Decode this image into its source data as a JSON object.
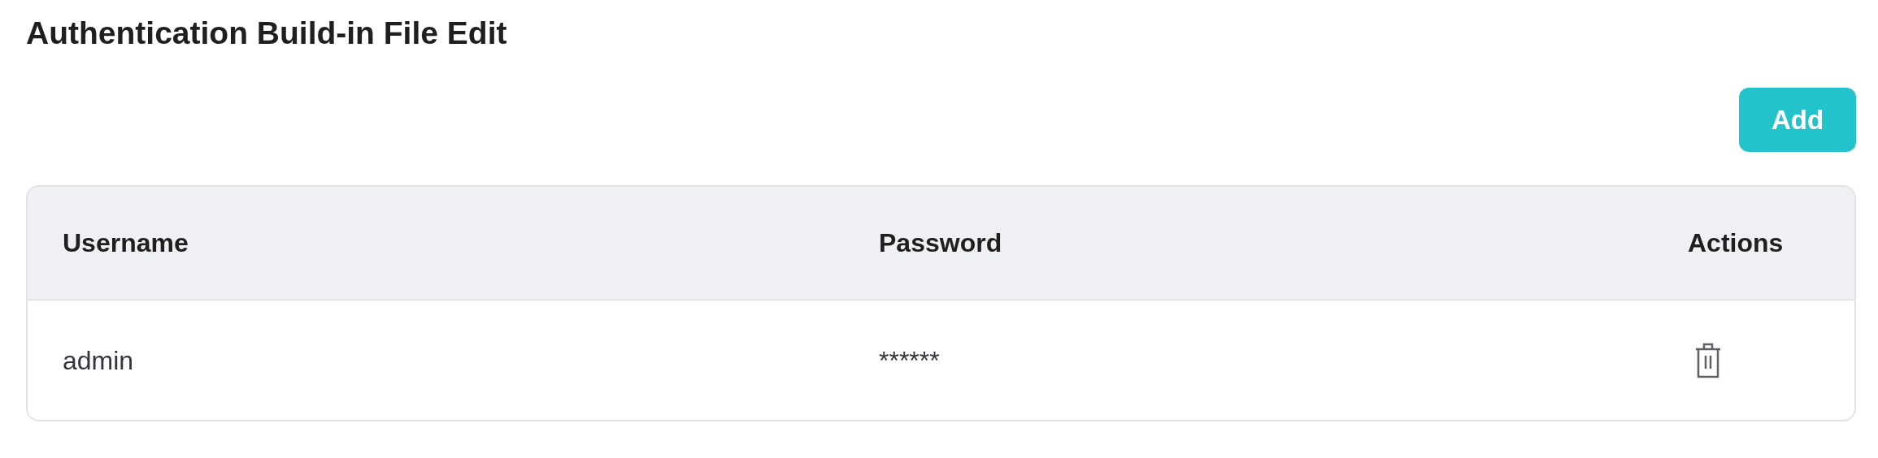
{
  "page": {
    "title": "Authentication Build-in File Edit"
  },
  "add_button": {
    "label": "Add"
  },
  "table": {
    "columns": [
      "Username",
      "Password",
      "Actions"
    ],
    "rows": [
      {
        "username": "admin",
        "password": "******"
      }
    ]
  }
}
